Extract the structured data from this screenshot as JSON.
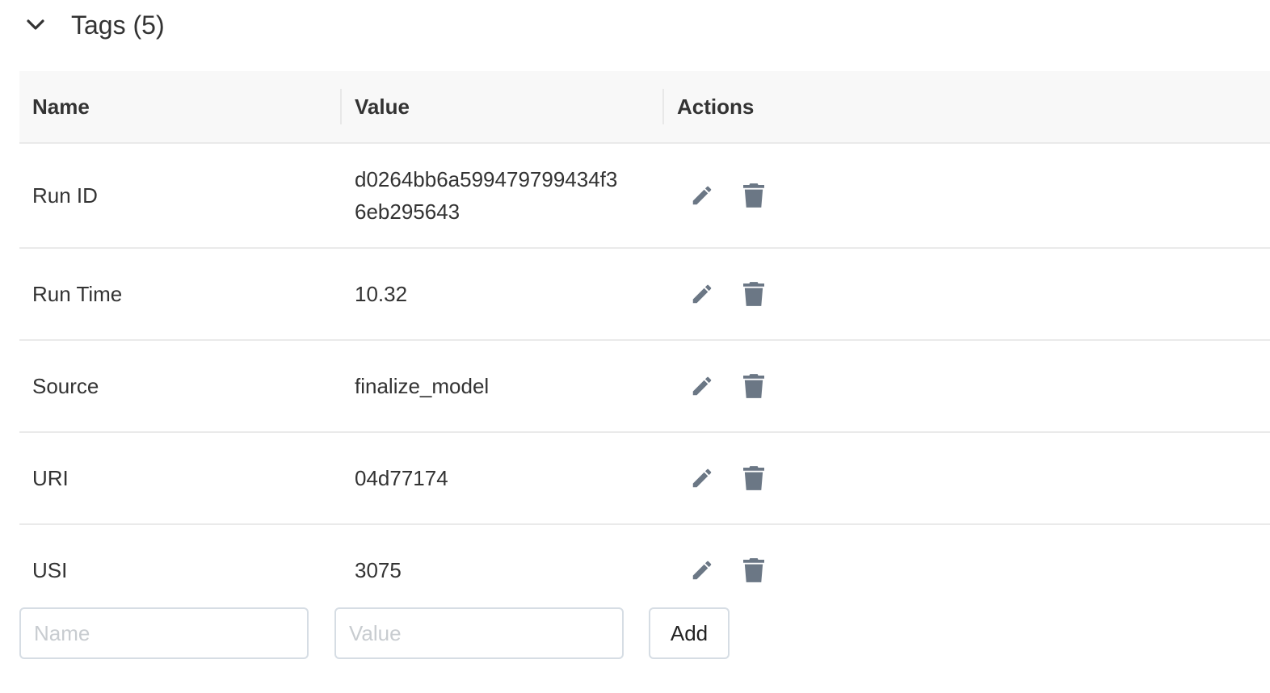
{
  "section": {
    "title": "Tags (5)",
    "expanded": true
  },
  "table": {
    "columns": [
      "Name",
      "Value",
      "Actions"
    ],
    "rows": [
      {
        "name": "Run ID",
        "value_lines": [
          "d0264bb6a599479799434f3",
          "6eb295643"
        ]
      },
      {
        "name": "Run Time",
        "value_lines": [
          "10.32"
        ]
      },
      {
        "name": "Source",
        "value_lines": [
          "finalize_model"
        ]
      },
      {
        "name": "URI",
        "value_lines": [
          "04d77174"
        ]
      },
      {
        "name": "USI",
        "value_lines": [
          "3075"
        ]
      }
    ]
  },
  "icons": {
    "collapse": "chevron-down-icon",
    "edit": "pencil-icon",
    "delete": "trash-icon"
  },
  "colors": {
    "icon": "#6b7785",
    "header_bg": "#f8f8f8",
    "border": "#eaeaea"
  },
  "form": {
    "name_placeholder": "Name",
    "value_placeholder": "Value",
    "add_label": "Add"
  }
}
